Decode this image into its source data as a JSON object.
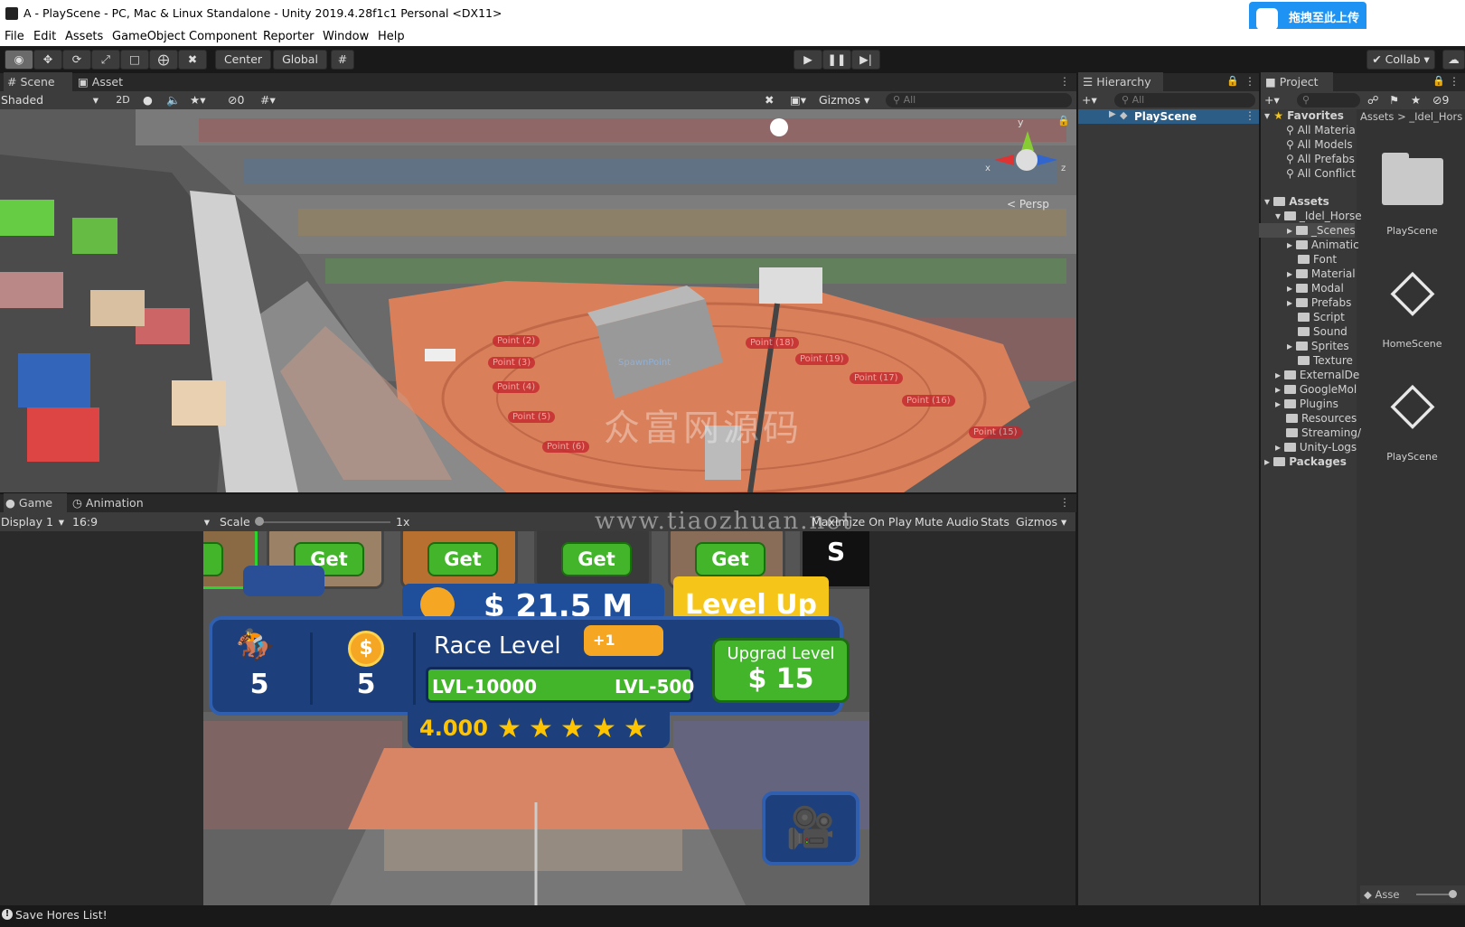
{
  "window": {
    "title": "A - PlayScene - PC, Mac & Linux Standalone - Unity 2019.4.28f1c1 Personal <DX11>"
  },
  "upload_badge": "拖拽至此上传",
  "menu": [
    "File",
    "Edit",
    "Assets",
    "GameObject",
    "Component",
    "Reporter",
    "Window",
    "Help"
  ],
  "toolbar": {
    "center": "Center",
    "global": "Global",
    "collab": "Collab"
  },
  "scene_panel": {
    "tabs": [
      "Scene",
      "Asset Store"
    ],
    "shading": "Shaded",
    "mode2d": "2D",
    "hidden_count": "0",
    "gizmos": "Gizmos",
    "search_placeholder": "All",
    "axis_y": "y",
    "axis_x": "x",
    "axis_z": "z",
    "persp": "< Persp",
    "spawn_label": "SpawnPoint",
    "points": [
      "Point (2)",
      "Point (3)",
      "Point (4)",
      "Point (5)",
      "Point (6)",
      "Point (18)",
      "Point (19)",
      "Point (17)",
      "Point (16)",
      "Point (15)"
    ],
    "watermark_cn": "众富网源码",
    "watermark_url": "www.tiaozhuan.net"
  },
  "game_panel": {
    "tabs": [
      "Game",
      "Animation"
    ],
    "display": "Display 1",
    "aspect": "16:9",
    "scale_label": "Scale",
    "scale_value": "1x",
    "maximize": "Maximize On Play",
    "mute": "Mute Audio",
    "stats": "Stats",
    "gizmos": "Gizmos"
  },
  "game_ui": {
    "get_label": "Get",
    "s_label": "S",
    "money": "$ 21.5 M",
    "level_up": "Level Up",
    "horse_count": "5",
    "coin_count": "5",
    "race_level": "Race Level",
    "plus_one": "+1",
    "lvl_left": "LVL-10000",
    "lvl_right": "LVL-500",
    "upgrade_title": "Upgrad Level",
    "upgrade_price": "$ 15",
    "rating": "4.000",
    "stars": 5
  },
  "hierarchy": {
    "title": "Hierarchy",
    "search_placeholder": "All",
    "root": "PlayScene"
  },
  "project": {
    "title": "Project",
    "breadcrumb": "Assets  >  _Idel_Hors",
    "favorites": "Favorites",
    "fav_items": [
      "All Materia",
      "All Models",
      "All Prefabs",
      "All Conflict"
    ],
    "assets": "Assets",
    "root_folder": "_Idel_Horse",
    "sub_folders": [
      "_Scenes",
      "Animatic",
      "Font",
      "Material",
      "Modal",
      "Prefabs",
      "Script",
      "Sound",
      "Sprites",
      "Texture"
    ],
    "top_folders": [
      "ExternalDe",
      "GoogleMol",
      "Plugins",
      "Resources",
      "Streaming/",
      "Unity-Logs"
    ],
    "packages": "Packages",
    "grid_items": [
      "PlayScene",
      "HomeScene",
      "PlayScene"
    ],
    "footer": "Asse",
    "count_badge": "9"
  },
  "status": {
    "message": "Save Hores List!"
  }
}
